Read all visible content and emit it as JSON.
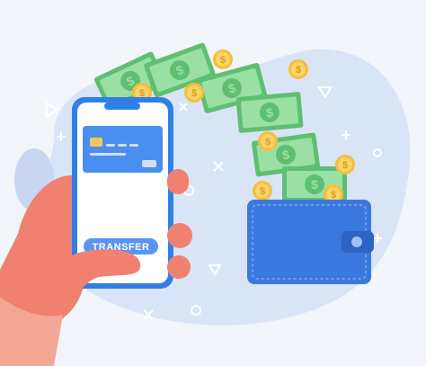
{
  "illustration": {
    "transfer_button_label": "TRANSFER",
    "bill_symbol": "$",
    "coin_symbol": "$"
  },
  "colors": {
    "background": "#f2f6fb",
    "blob": "#d9e4f7",
    "blob_shadow": "#bfcff0",
    "phone_frame": "#2f7fe6",
    "phone_screen": "#ffffff",
    "card": "#4a8ff0",
    "card_chip": "#f5c65a",
    "button": "#5a94f0",
    "bill_dark": "#5ebf72",
    "bill_light": "#9ae0a4",
    "coin": "#f7bd3c",
    "coin_inner": "#fbd46a",
    "wallet": "#3b78dd",
    "wallet_dark": "#2d63c2",
    "hand": "#f08070",
    "hand_dark": "#e06a5c",
    "sleeve": "#f0a090",
    "sparkle": "#ffffff"
  }
}
